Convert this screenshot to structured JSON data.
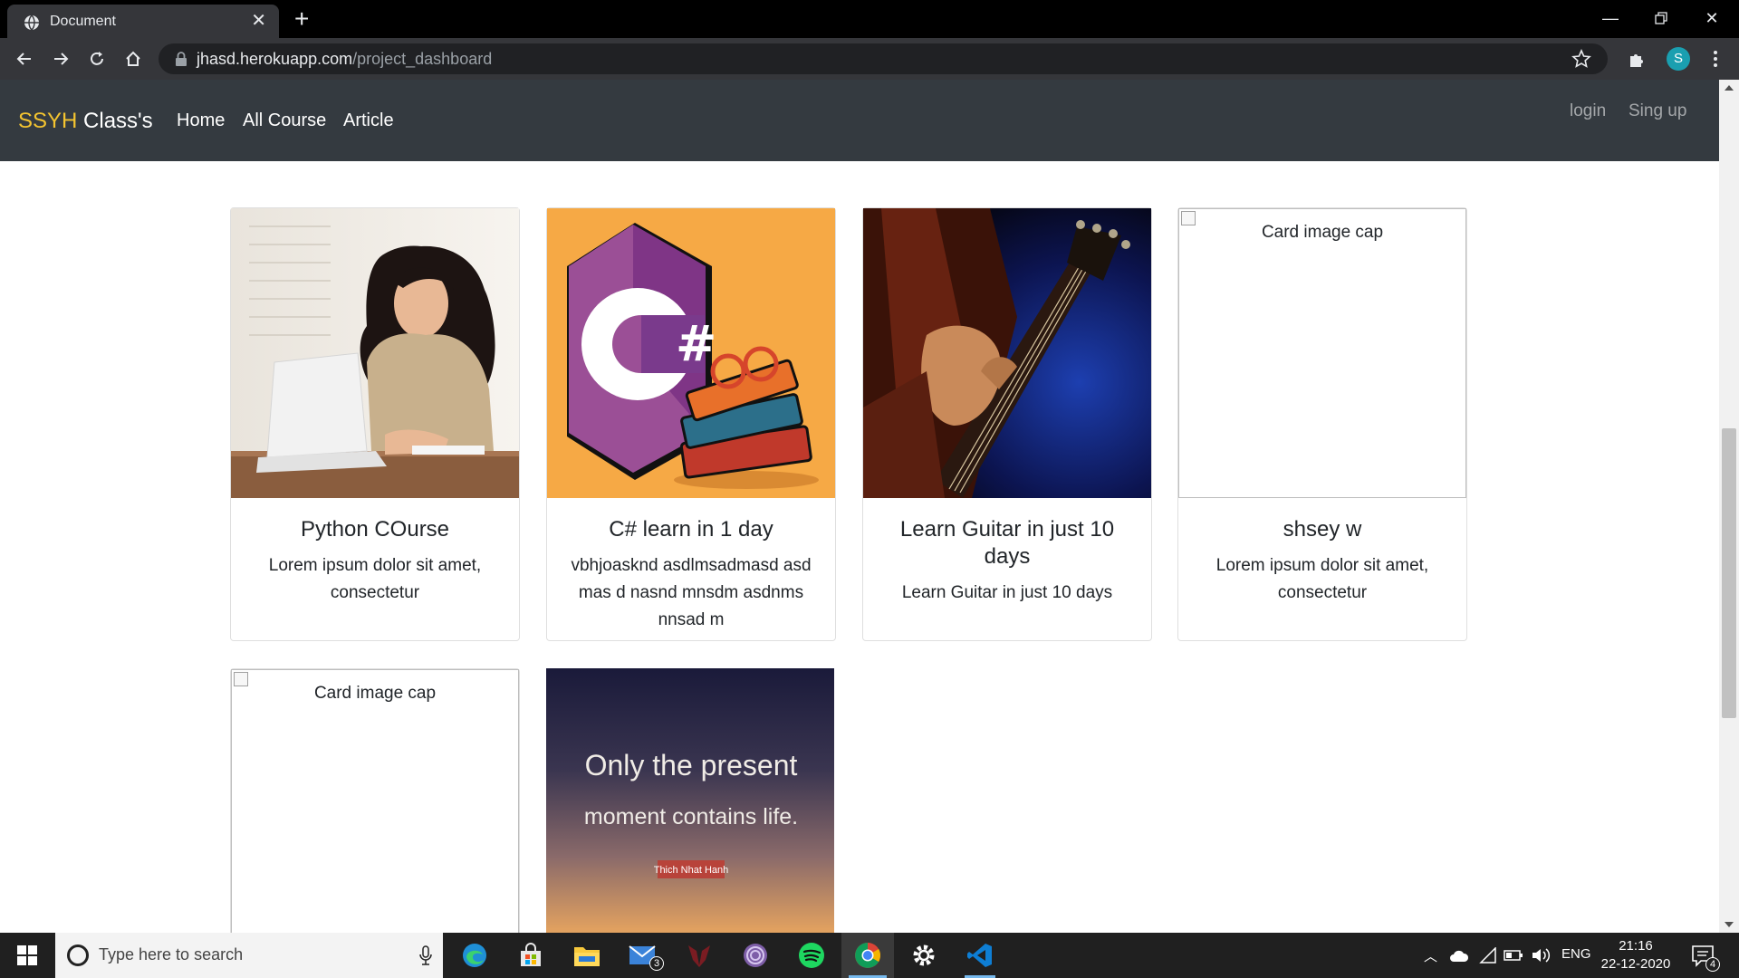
{
  "browser": {
    "tab_title": "Document",
    "url_host": "jhasd.herokuapp.com",
    "url_path": "/project_dashboard",
    "profile_initial": "S"
  },
  "navbar": {
    "brand_accent": "SSYH",
    "brand_rest": " Class's",
    "links": [
      "Home",
      "All Course",
      "Article"
    ],
    "login": "login",
    "signup": "Sing up"
  },
  "cards": [
    {
      "title": "Python COurse",
      "text": "Lorem ipsum dolor sit amet, consectetur",
      "image": "woman-laptop-photo"
    },
    {
      "title": "C# learn in 1 day",
      "text": "vbhjoasknd asdlmsadmasd asd mas d nasnd mnsdm asdnms nnsad m",
      "image": "csharp-logo-books"
    },
    {
      "title": "Learn Guitar in just 10 days",
      "text": "Learn Guitar in just 10 days",
      "image": "guitar-photo"
    },
    {
      "title": "shsey w",
      "text": "Lorem ipsum dolor sit amet, consectetur",
      "image_alt": "Card image cap"
    },
    {
      "image_alt": "Card image cap"
    },
    {
      "image": "quote-sunset",
      "quote_line1": "Only the present",
      "quote_line2": "moment contains life.",
      "quote_author": "Thich Nhat Hanh"
    }
  ],
  "taskbar": {
    "search_placeholder": "Type here to search",
    "mail_badge": "3",
    "lang": "ENG",
    "time": "21:16",
    "date": "22-12-2020",
    "notification_count": "4"
  },
  "colors": {
    "navbar_bg": "#343a40",
    "brand_accent": "#f4c430",
    "chrome_bg": "#35363a",
    "csharp_bg": "#f6a945",
    "csharp_purple": "#8a4bb0"
  }
}
